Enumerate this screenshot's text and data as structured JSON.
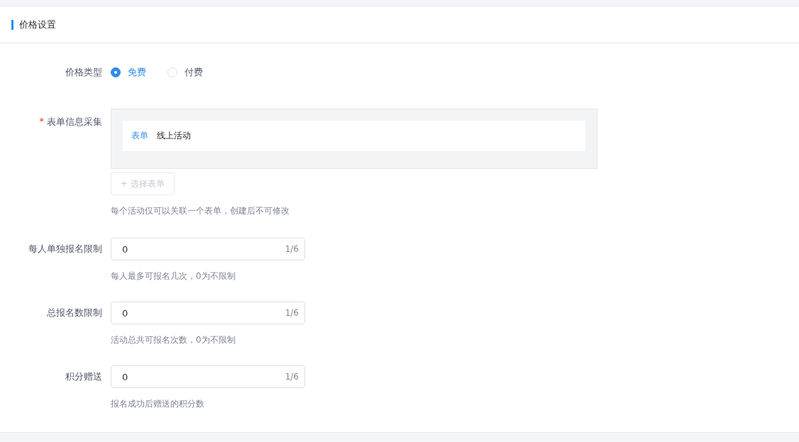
{
  "section": {
    "title": "价格设置"
  },
  "fields": [
    {
      "kind": "radio",
      "label": "价格类型",
      "options": [
        {
          "label": "免费",
          "selected": true
        },
        {
          "label": "付费",
          "selected": false
        }
      ]
    },
    {
      "kind": "form_picker",
      "label": "表单信息采集",
      "required_mark": "*",
      "form_tag": "表单",
      "form_name": "线上活动",
      "button": "+ 选择表单",
      "hint": "每个活动仅可以关联一个表单，创建后不可修改"
    },
    {
      "kind": "number",
      "label": "每人单独报名限制",
      "value": "0",
      "counter": "1/6",
      "hint": "每人最多可报名几次，0为不限制"
    },
    {
      "kind": "number",
      "label": "总报名数限制",
      "value": "0",
      "counter": "1/6",
      "hint": "活动总共可报名次数，0为不限制"
    },
    {
      "kind": "number",
      "label": "积分赠送",
      "value": "0",
      "counter": "1/6",
      "hint": "报名成功后赠送的积分数"
    }
  ]
}
